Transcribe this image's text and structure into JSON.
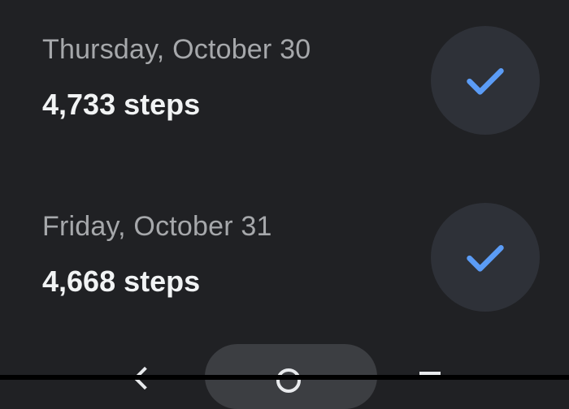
{
  "entries": [
    {
      "date": "Thursday, October 30",
      "steps": "4,733 steps",
      "completed": true
    },
    {
      "date": "Friday, October 31",
      "steps": "4,668 steps",
      "completed": true
    }
  ],
  "icons": {
    "check": "checkmark-icon",
    "back": "back-chevron-icon",
    "home": "home-icon",
    "menu": "menu-icon"
  },
  "colors": {
    "background": "#202124",
    "date_text": "#a6a8ab",
    "steps_text": "#f1f3f4",
    "check_circle": "#2e3138",
    "check_mark": "#5b9cf6",
    "nav_pill": "#3c3e42"
  }
}
